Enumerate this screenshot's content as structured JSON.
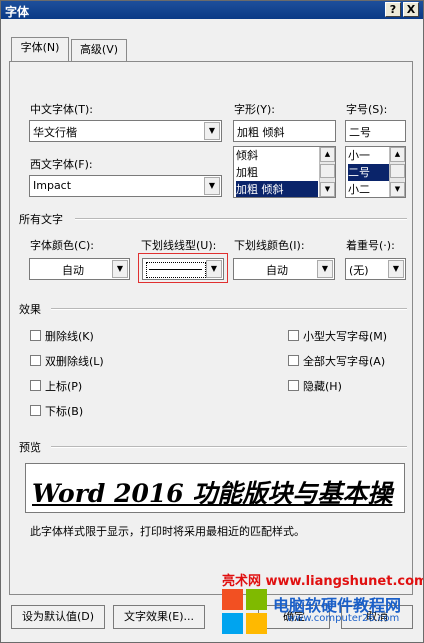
{
  "window": {
    "title": "字体",
    "help_button": "?",
    "close_button": "X"
  },
  "tabs": [
    {
      "label": "字体(N)"
    },
    {
      "label": "高级(V)"
    }
  ],
  "font": {
    "chinese_label": "中文字体(T):",
    "chinese_value": "华文行楷",
    "western_label": "西文字体(F):",
    "western_value": "Impact",
    "style_label": "字形(Y):",
    "style_value": "加粗 倾斜",
    "style_options": [
      "倾斜",
      "加粗",
      "加粗 倾斜"
    ],
    "size_label": "字号(S):",
    "size_value": "二号",
    "size_options": [
      "小一",
      "二号",
      "小二"
    ]
  },
  "all_text": {
    "section_label": "所有文字",
    "font_color_label": "字体颜色(C):",
    "font_color_value": "自动",
    "underline_type_label": "下划线线型(U):",
    "underline_color_label": "下划线颜色(I):",
    "underline_color_value": "自动",
    "emphasis_label": "着重号(·):",
    "emphasis_value": "(无)"
  },
  "effects": {
    "section_label": "效果",
    "left": [
      "删除线(K)",
      "双删除线(L)",
      "上标(P)",
      "下标(B)"
    ],
    "right": [
      "小型大写字母(M)",
      "全部大写字母(A)",
      "隐藏(H)"
    ]
  },
  "preview": {
    "section_label": "预览",
    "sample_text": "Word 2016 功能版块与基本操",
    "note": "此字体样式限于显示，打印时将采用最相近的匹配样式。"
  },
  "buttons": {
    "set_default": "设为默认值(D)",
    "text_effects": "文字效果(E)...",
    "ok": "确定",
    "cancel": "取消"
  },
  "watermark": {
    "site1": "亮术网 www.liangshunet.com",
    "site2_name": "电脑软硬件教程网",
    "site2_url": "www.computer26.com"
  }
}
